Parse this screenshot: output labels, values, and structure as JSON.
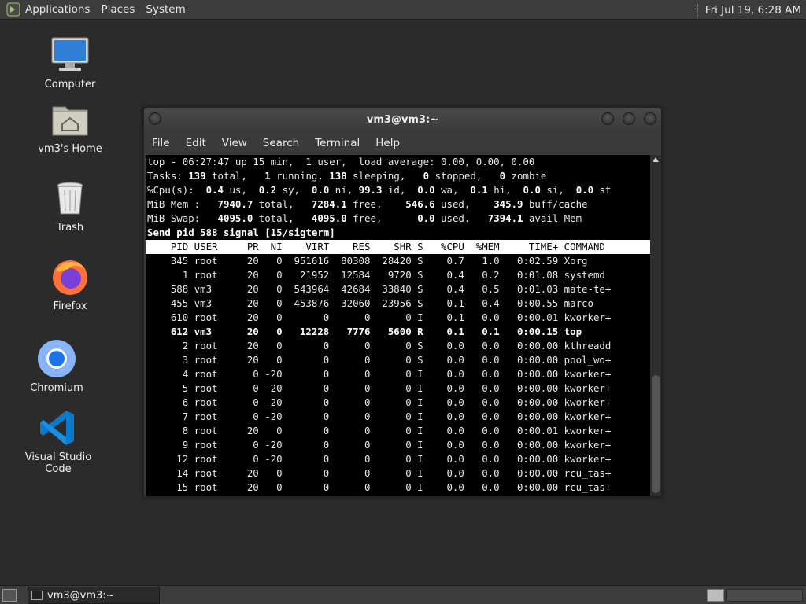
{
  "top_panel": {
    "menus": [
      "Applications",
      "Places",
      "System"
    ],
    "clock": "Fri Jul 19,  6:28 AM"
  },
  "desktop": {
    "icons": [
      {
        "label": "Computer",
        "icon": "computer-icon"
      },
      {
        "label": "vm3's Home",
        "icon": "home-folder-icon"
      },
      {
        "label": "Trash",
        "icon": "trash-icon"
      },
      {
        "label": "Firefox",
        "icon": "firefox-icon"
      },
      {
        "label": "Chromium",
        "icon": "chromium-icon"
      },
      {
        "label": "Visual Studio Code",
        "icon": "vscode-icon"
      }
    ]
  },
  "window": {
    "title": "vm3@vm3:~",
    "menus": [
      "File",
      "Edit",
      "View",
      "Search",
      "Terminal",
      "Help"
    ]
  },
  "top": {
    "summary": {
      "line1": "top - 06:27:47 up 15 min,  1 user,  load average: 0.00, 0.00, 0.00",
      "tasks": {
        "total": "139",
        "running": "1",
        "sleeping": "138",
        "stopped": "0",
        "zombie": "0"
      },
      "cpu": {
        "us": "0.4",
        "sy": "0.2",
        "ni": "0.0",
        "id": "99.3",
        "wa": "0.0",
        "hi": "0.1",
        "si": "0.0",
        "st": "0.0"
      },
      "mem": {
        "total": "7940.7",
        "free": "7284.1",
        "used": "546.6",
        "buff_cache": "345.9"
      },
      "swap": {
        "total": "4095.0",
        "free": "4095.0",
        "used": "0.0",
        "avail": "7394.1"
      }
    },
    "prompt": "Send pid 588 signal [15/sigterm]",
    "columns": [
      "PID",
      "USER",
      "PR",
      "NI",
      "VIRT",
      "RES",
      "SHR",
      "S",
      "%CPU",
      "%MEM",
      "TIME+",
      "COMMAND"
    ],
    "rows": [
      [
        "345",
        "root",
        "20",
        "0",
        "951616",
        "80308",
        "28420",
        "S",
        "0.7",
        "1.0",
        "0:02.59",
        "Xorg"
      ],
      [
        "1",
        "root",
        "20",
        "0",
        "21952",
        "12584",
        "9720",
        "S",
        "0.4",
        "0.2",
        "0:01.08",
        "systemd"
      ],
      [
        "588",
        "vm3",
        "20",
        "0",
        "543964",
        "42684",
        "33840",
        "S",
        "0.4",
        "0.5",
        "0:01.03",
        "mate-te+"
      ],
      [
        "455",
        "vm3",
        "20",
        "0",
        "453876",
        "32060",
        "23956",
        "S",
        "0.1",
        "0.4",
        "0:00.55",
        "marco"
      ],
      [
        "610",
        "root",
        "20",
        "0",
        "0",
        "0",
        "0",
        "I",
        "0.1",
        "0.0",
        "0:00.01",
        "kworker+"
      ],
      [
        "612",
        "vm3",
        "20",
        "0",
        "12228",
        "7776",
        "5600",
        "R",
        "0.1",
        "0.1",
        "0:00.15",
        "top"
      ],
      [
        "2",
        "root",
        "20",
        "0",
        "0",
        "0",
        "0",
        "S",
        "0.0",
        "0.0",
        "0:00.00",
        "kthreadd"
      ],
      [
        "3",
        "root",
        "20",
        "0",
        "0",
        "0",
        "0",
        "S",
        "0.0",
        "0.0",
        "0:00.00",
        "pool_wo+"
      ],
      [
        "4",
        "root",
        "0",
        "-20",
        "0",
        "0",
        "0",
        "I",
        "0.0",
        "0.0",
        "0:00.00",
        "kworker+"
      ],
      [
        "5",
        "root",
        "0",
        "-20",
        "0",
        "0",
        "0",
        "I",
        "0.0",
        "0.0",
        "0:00.00",
        "kworker+"
      ],
      [
        "6",
        "root",
        "0",
        "-20",
        "0",
        "0",
        "0",
        "I",
        "0.0",
        "0.0",
        "0:00.00",
        "kworker+"
      ],
      [
        "7",
        "root",
        "0",
        "-20",
        "0",
        "0",
        "0",
        "I",
        "0.0",
        "0.0",
        "0:00.00",
        "kworker+"
      ],
      [
        "8",
        "root",
        "20",
        "0",
        "0",
        "0",
        "0",
        "I",
        "0.0",
        "0.0",
        "0:00.01",
        "kworker+"
      ],
      [
        "9",
        "root",
        "0",
        "-20",
        "0",
        "0",
        "0",
        "I",
        "0.0",
        "0.0",
        "0:00.00",
        "kworker+"
      ],
      [
        "12",
        "root",
        "0",
        "-20",
        "0",
        "0",
        "0",
        "I",
        "0.0",
        "0.0",
        "0:00.00",
        "kworker+"
      ],
      [
        "14",
        "root",
        "20",
        "0",
        "0",
        "0",
        "0",
        "I",
        "0.0",
        "0.0",
        "0:00.00",
        "rcu_tas+"
      ],
      [
        "15",
        "root",
        "20",
        "0",
        "0",
        "0",
        "0",
        "I",
        "0.0",
        "0.0",
        "0:00.00",
        "rcu_tas+"
      ]
    ],
    "highlight_pid": "612"
  },
  "bottom_panel": {
    "task_label": "vm3@vm3:~"
  },
  "colors": {
    "desktop_bg": "#2b2b2b",
    "panel_bg": "#3c3c3c",
    "terminal_bg": "#000000",
    "header_bg": "#ffffff"
  }
}
